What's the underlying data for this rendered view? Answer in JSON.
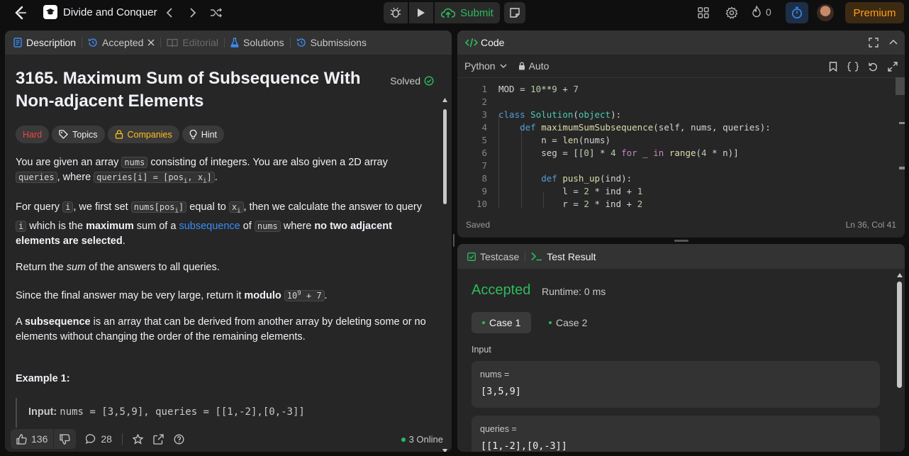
{
  "topbar": {
    "problem_list_title": "Divide and Conquer",
    "submit_label": "Submit",
    "streak_count": "0",
    "premium_label": "Premium"
  },
  "tabs": {
    "description": "Description",
    "accepted": "Accepted",
    "editorial": "Editorial",
    "solutions": "Solutions",
    "submissions": "Submissions"
  },
  "problem": {
    "title": "3165. Maximum Sum of Subsequence With Non-adjacent Elements",
    "status": "Solved",
    "difficulty": "Hard",
    "topics_label": "Topics",
    "companies_label": "Companies",
    "hint_label": "Hint",
    "p1": {
      "a": "You are given an array ",
      "c1": "nums",
      "b": " consisting of integers. You are also given a 2D array ",
      "c2": "queries",
      "c": ", where ",
      "c3": "queries[i] = [pos",
      "c3_sub1": "i",
      "c3_mid": ", x",
      "c3_sub2": "i",
      "c3_end": "]",
      "d": "."
    },
    "p2": {
      "a": "For query ",
      "c1": "i",
      "b": ", we first set ",
      "c2": "nums[pos",
      "c2_sub": "i",
      "c2_end": "]",
      "c": " equal to ",
      "c3": "x",
      "c3_sub": "i",
      "d": ", then we calculate the answer to query ",
      "c4": "i",
      "e": " which is the ",
      "b1": "maximum",
      "f": " sum of a ",
      "link": "subsequence",
      "g": " of ",
      "c5": "nums",
      "h": " where ",
      "b2": "no two adjacent elements are selected",
      "i": "."
    },
    "p3": {
      "a": "Return the ",
      "em": "sum",
      "b": " of the answers to all queries."
    },
    "p4": {
      "a": "Since the final answer may be very large, return it ",
      "b1": "modulo",
      "c1": "10",
      "c1_sup": "9",
      "c1_end": " + 7",
      "d": "."
    },
    "p5": {
      "b1": "subsequence",
      "a": "A ",
      "b": " is an array that can be derived from another array by deleting some or no elements without changing the order of the remaining elements."
    },
    "example_title": "Example 1:",
    "example_input_label": "Input:",
    "example_input_value": "nums = [3,5,9], queries = [[1,-2],[0,-3]]"
  },
  "footer": {
    "likes": "136",
    "comments": "28",
    "online": "3 Online"
  },
  "code": {
    "tab_label": "Code",
    "language": "Python",
    "mode": "Auto",
    "status": "Saved",
    "cursor": "Ln 36, Col 41",
    "lines": [
      {
        "n": "1"
      },
      {
        "n": "2"
      },
      {
        "n": "3"
      },
      {
        "n": "4"
      },
      {
        "n": "5"
      },
      {
        "n": "6"
      },
      {
        "n": "7"
      },
      {
        "n": "8"
      },
      {
        "n": "9"
      },
      {
        "n": "10"
      }
    ]
  },
  "test": {
    "testcase_label": "Testcase",
    "result_label": "Test Result",
    "verdict": "Accepted",
    "runtime": "Runtime: 0 ms",
    "case1": "Case 1",
    "case2": "Case 2",
    "input_label": "Input",
    "vars": [
      {
        "name": "nums =",
        "value": "[3,5,9]"
      },
      {
        "name": "queries =",
        "value": "[[1,-2],[0,-3]]"
      }
    ]
  }
}
